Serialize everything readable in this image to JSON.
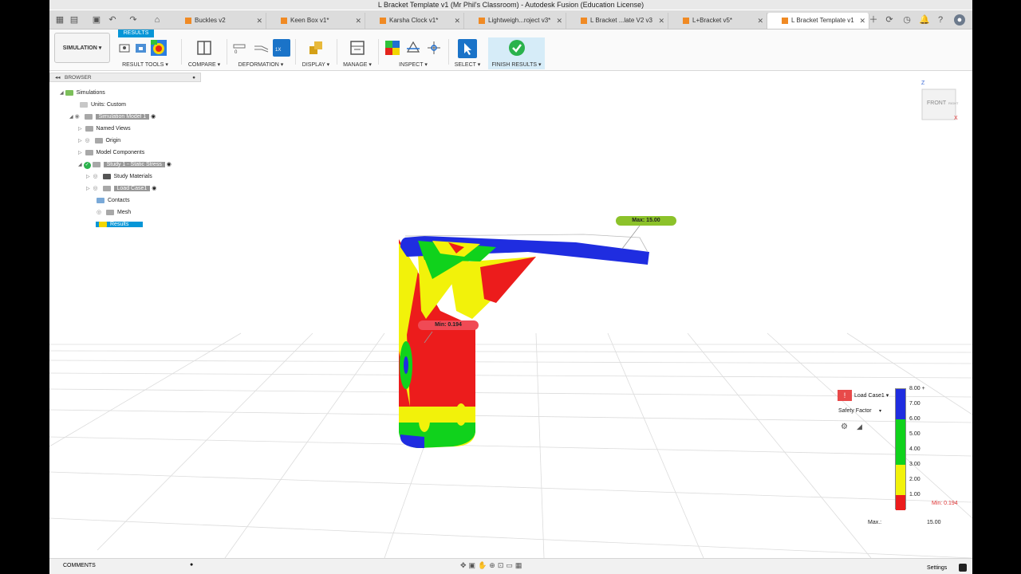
{
  "window": {
    "title": "L Bracket Template v1 (Mr Phil's Classroom) - Autodesk Fusion (Education License)"
  },
  "tabs": [
    {
      "label": "Buckles v2"
    },
    {
      "label": "Keen Box v1*"
    },
    {
      "label": "Karsha Clock v1*"
    },
    {
      "label": "Lightweigh...roject v3*"
    },
    {
      "label": "L Bracket ...late V2 v3"
    },
    {
      "label": "L+Bracket v5*"
    },
    {
      "label": "L Bracket Template v1"
    }
  ],
  "ribbon": {
    "workspace": "SIMULATION ▾",
    "active_tab": "RESULTS",
    "groups": [
      {
        "label": "RESULT TOOLS ▾"
      },
      {
        "label": "COMPARE ▾"
      },
      {
        "label": "DEFORMATION ▾"
      },
      {
        "label": "DISPLAY ▾"
      },
      {
        "label": "MANAGE ▾"
      },
      {
        "label": "INSPECT ▾"
      },
      {
        "label": "SELECT ▾"
      },
      {
        "label": "FINISH RESULTS ▾"
      }
    ],
    "deformation_scale": "0",
    "deformation_value": "1X"
  },
  "browser": {
    "header": "BROWSER",
    "items": [
      {
        "label": "Simulations"
      },
      {
        "label": "Units: Custom"
      },
      {
        "label": "Simulation Model 1"
      },
      {
        "label": "Named Views"
      },
      {
        "label": "Origin"
      },
      {
        "label": "Model Components"
      },
      {
        "label": "Study 1 - Static Stress"
      },
      {
        "label": "Study Materials"
      },
      {
        "label": "Load Case1"
      },
      {
        "label": "Contacts"
      },
      {
        "label": "Mesh"
      },
      {
        "label": "Results"
      }
    ]
  },
  "viewcube": {
    "face": "FRONT",
    "side": "RIGHT",
    "z": "Z",
    "x": "X"
  },
  "callouts": {
    "max": "Max: 15.00",
    "min": "Min: 0.194"
  },
  "legend": {
    "load_case": "Load Case1 ▾",
    "result_type": "Safety Factor",
    "ticks": [
      "8.00 +",
      "7.00",
      "6.00",
      "5.00",
      "4.00",
      "3.00",
      "2.00",
      "1.00"
    ],
    "min_label": "Min: 0.194",
    "max_label": "Max.:",
    "max_value": "15.00",
    "colors": {
      "blue": "#1f2de0",
      "green": "#10d21c",
      "yellow": "#f2f20a",
      "red": "#ec1c1c"
    }
  },
  "bottom": {
    "comments": "COMMENTS",
    "settings": "Settings"
  }
}
